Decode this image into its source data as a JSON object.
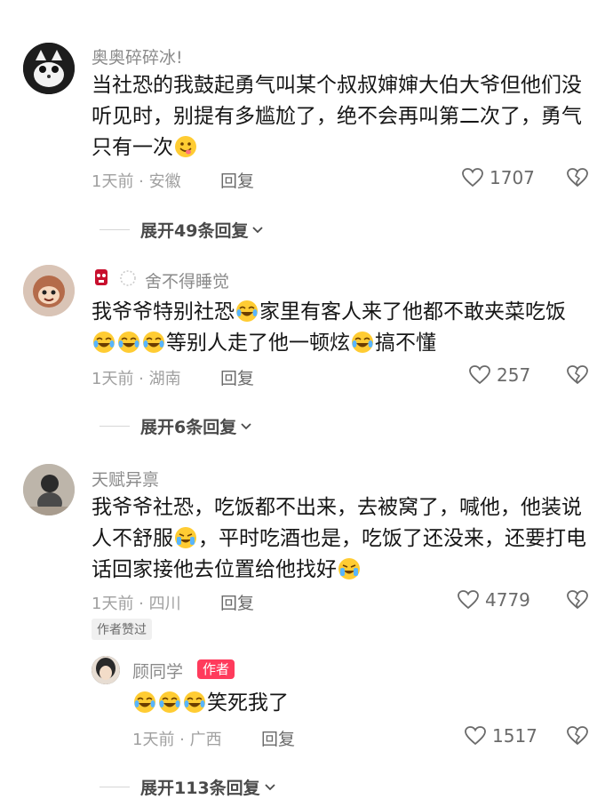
{
  "comments": [
    {
      "username": "奥奥碎碎冰!",
      "text_parts": [
        "当社恐的我鼓起勇气叫某个叔叔婶婶大伯大爷但他们没听见时，别提有多尴尬了，绝不会再叫第二次了，勇气只有一次"
      ],
      "meta": "1天前 · 安徽",
      "reply_label": "回复",
      "likes": "1707",
      "expand_label": "展开49条回复"
    },
    {
      "username": "舍不得睡觉",
      "text_a": "我爷爷特别社恐",
      "text_b": "家里有客人来了他都不敢夹菜吃饭",
      "text_c": "等别人走了他一顿炫",
      "text_d": "搞不懂",
      "meta": "1天前 · 湖南",
      "reply_label": "回复",
      "likes": "257",
      "expand_label": "展开6条回复"
    },
    {
      "username": "天赋异禀",
      "text_a": "我爷爷社恐，吃饭都不出来，去被窝了，喊他，他装说人不舒服",
      "text_b": "，平时吃酒也是，吃饭了还没来，还要打电话回家接他去位置给他找好",
      "meta": "1天前 · 四川",
      "reply_label": "回复",
      "likes": "4779",
      "author_liked": "作者赞过"
    }
  ],
  "reply": {
    "username": "顾同学",
    "author_badge": "作者",
    "text": "笑死我了",
    "meta": "1天前 · 广西",
    "reply_label": "回复",
    "likes": "1517",
    "expand_label": "展开113条回复"
  },
  "icons": {
    "like": "heart-outline-icon",
    "dislike": "broken-heart-icon",
    "expand": "chevron-down-icon",
    "emoji_smile": "tongue-smile-emoji",
    "emoji_laugh": "tears-of-joy-emoji",
    "emoji_cry": "crying-laugh-emoji"
  }
}
